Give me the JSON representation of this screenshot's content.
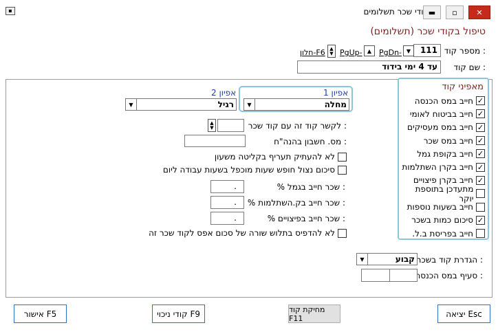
{
  "window": {
    "title": "קודי שכר תשלומים",
    "header": "טיפול בקודי שכר (תשלומים)"
  },
  "code": {
    "label": "מספר קוד :",
    "value": "111",
    "pgdn": "PgDn-",
    "pgup": "PgUp-",
    "f6": "חלון-F6"
  },
  "name": {
    "label": "שם קוד :",
    "value": "עד 4 ימי בידוד"
  },
  "properties": {
    "title": "מאפיני קוד",
    "items": [
      {
        "label": "חייב במס הכנסה",
        "checked": true
      },
      {
        "label": "חייב בביטוח לאומי",
        "checked": true
      },
      {
        "label": "חייב במס מעסיקים",
        "checked": true
      },
      {
        "label": "חייב במס שכר",
        "checked": true
      },
      {
        "label": "חייב בקופת גמל",
        "checked": true
      },
      {
        "label": "חייב בקרן השתלמות",
        "checked": true
      },
      {
        "label": "חייב בקרן פיצויים",
        "checked": true
      },
      {
        "label": "מתעדכן בתוספת יוקר",
        "checked": false
      },
      {
        "label": "חייב בשעות נוספות",
        "checked": false
      },
      {
        "label": "סיכום כמות בשכר",
        "checked": true
      },
      {
        "label": "חייב בפריסת ב.ל.",
        "checked": false
      }
    ]
  },
  "options": {
    "opt1_label": "אפיון 1",
    "opt1_value": "מחלה",
    "opt2_label": "אפיון 2",
    "opt2_value": "רגיל"
  },
  "links": {
    "link_label": "לקשר קוד זה עם קוד שכר :",
    "link_value": "",
    "account_label": "מס. חשבון בהנה\"ח :",
    "no_copy_rate": "לא להעתיק תעריף בקליטה משעון",
    "sick_hours": "סיכום נצול חופש שעות מוכפל בשעות עבודה ליום",
    "pension_pct_label": "% שכר חייב בגמל :",
    "pension_pct": ".",
    "study_pct_label": "% שכר חייב בק.השתלמות :",
    "study_pct": ".",
    "severance_pct_label": "% שכר חייב בפיצויים :",
    "severance_pct": ".",
    "no_print_zero": "לא להדפיס בתלוש שורה של סכום אפס לקוד שכר זה"
  },
  "definition": {
    "label": "הגדרת קוד בשכר :",
    "value": "קבוע",
    "tax_clause_label": "סעיף במס הכנסה :"
  },
  "buttons": {
    "exit": "יציאה Esc",
    "delete": "מחיקת קוד F11",
    "deductions": "קודי ניכוי F9",
    "confirm": "אישור F5"
  }
}
